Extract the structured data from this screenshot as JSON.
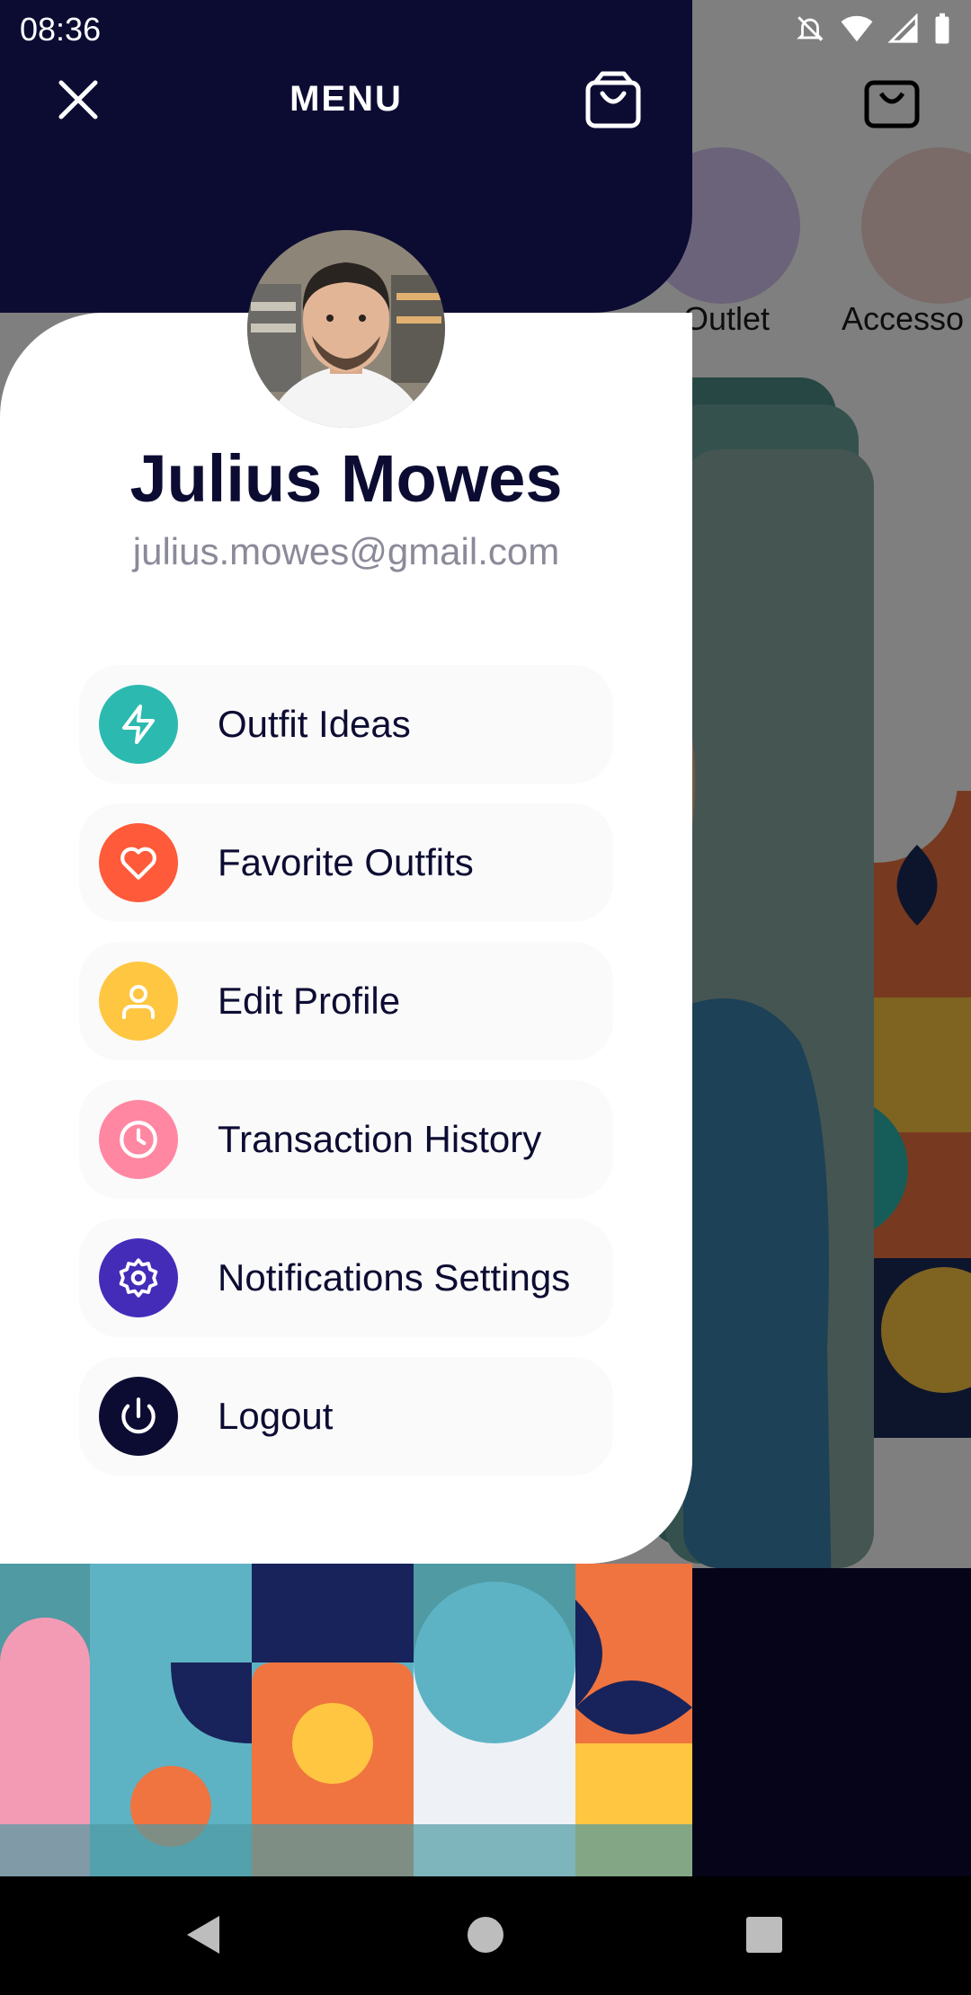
{
  "status_bar": {
    "time": "08:36",
    "icons": [
      "notifications-off-icon",
      "wifi-icon",
      "signal-icon",
      "battery-icon"
    ]
  },
  "drawer": {
    "title": "MENU",
    "close_icon": "close-icon",
    "cart_icon": "shopping-bag-icon",
    "user": {
      "name": "Julius Mowes",
      "email": "julius.mowes@gmail.com"
    },
    "items": [
      {
        "label": "Outfit Ideas",
        "icon": "bolt-icon",
        "color": "#2cb9b0"
      },
      {
        "label": "Favorite Outfits",
        "icon": "heart-icon",
        "color": "#ff5a39"
      },
      {
        "label": "Edit Profile",
        "icon": "user-icon",
        "color": "#ffc641"
      },
      {
        "label": "Transaction History",
        "icon": "clock-icon",
        "color": "#ff87a2"
      },
      {
        "label": "Notifications Settings",
        "icon": "settings-icon",
        "color": "#442cb9"
      },
      {
        "label": "Logout",
        "icon": "power-icon",
        "color": "#0c0c33"
      }
    ]
  },
  "background": {
    "categories": [
      "Outlet",
      "Accesso"
    ]
  },
  "colors": {
    "primary_dark": "#0c0c33",
    "accent_teal": "#2cb9b0",
    "text_muted": "#8a8a99"
  }
}
